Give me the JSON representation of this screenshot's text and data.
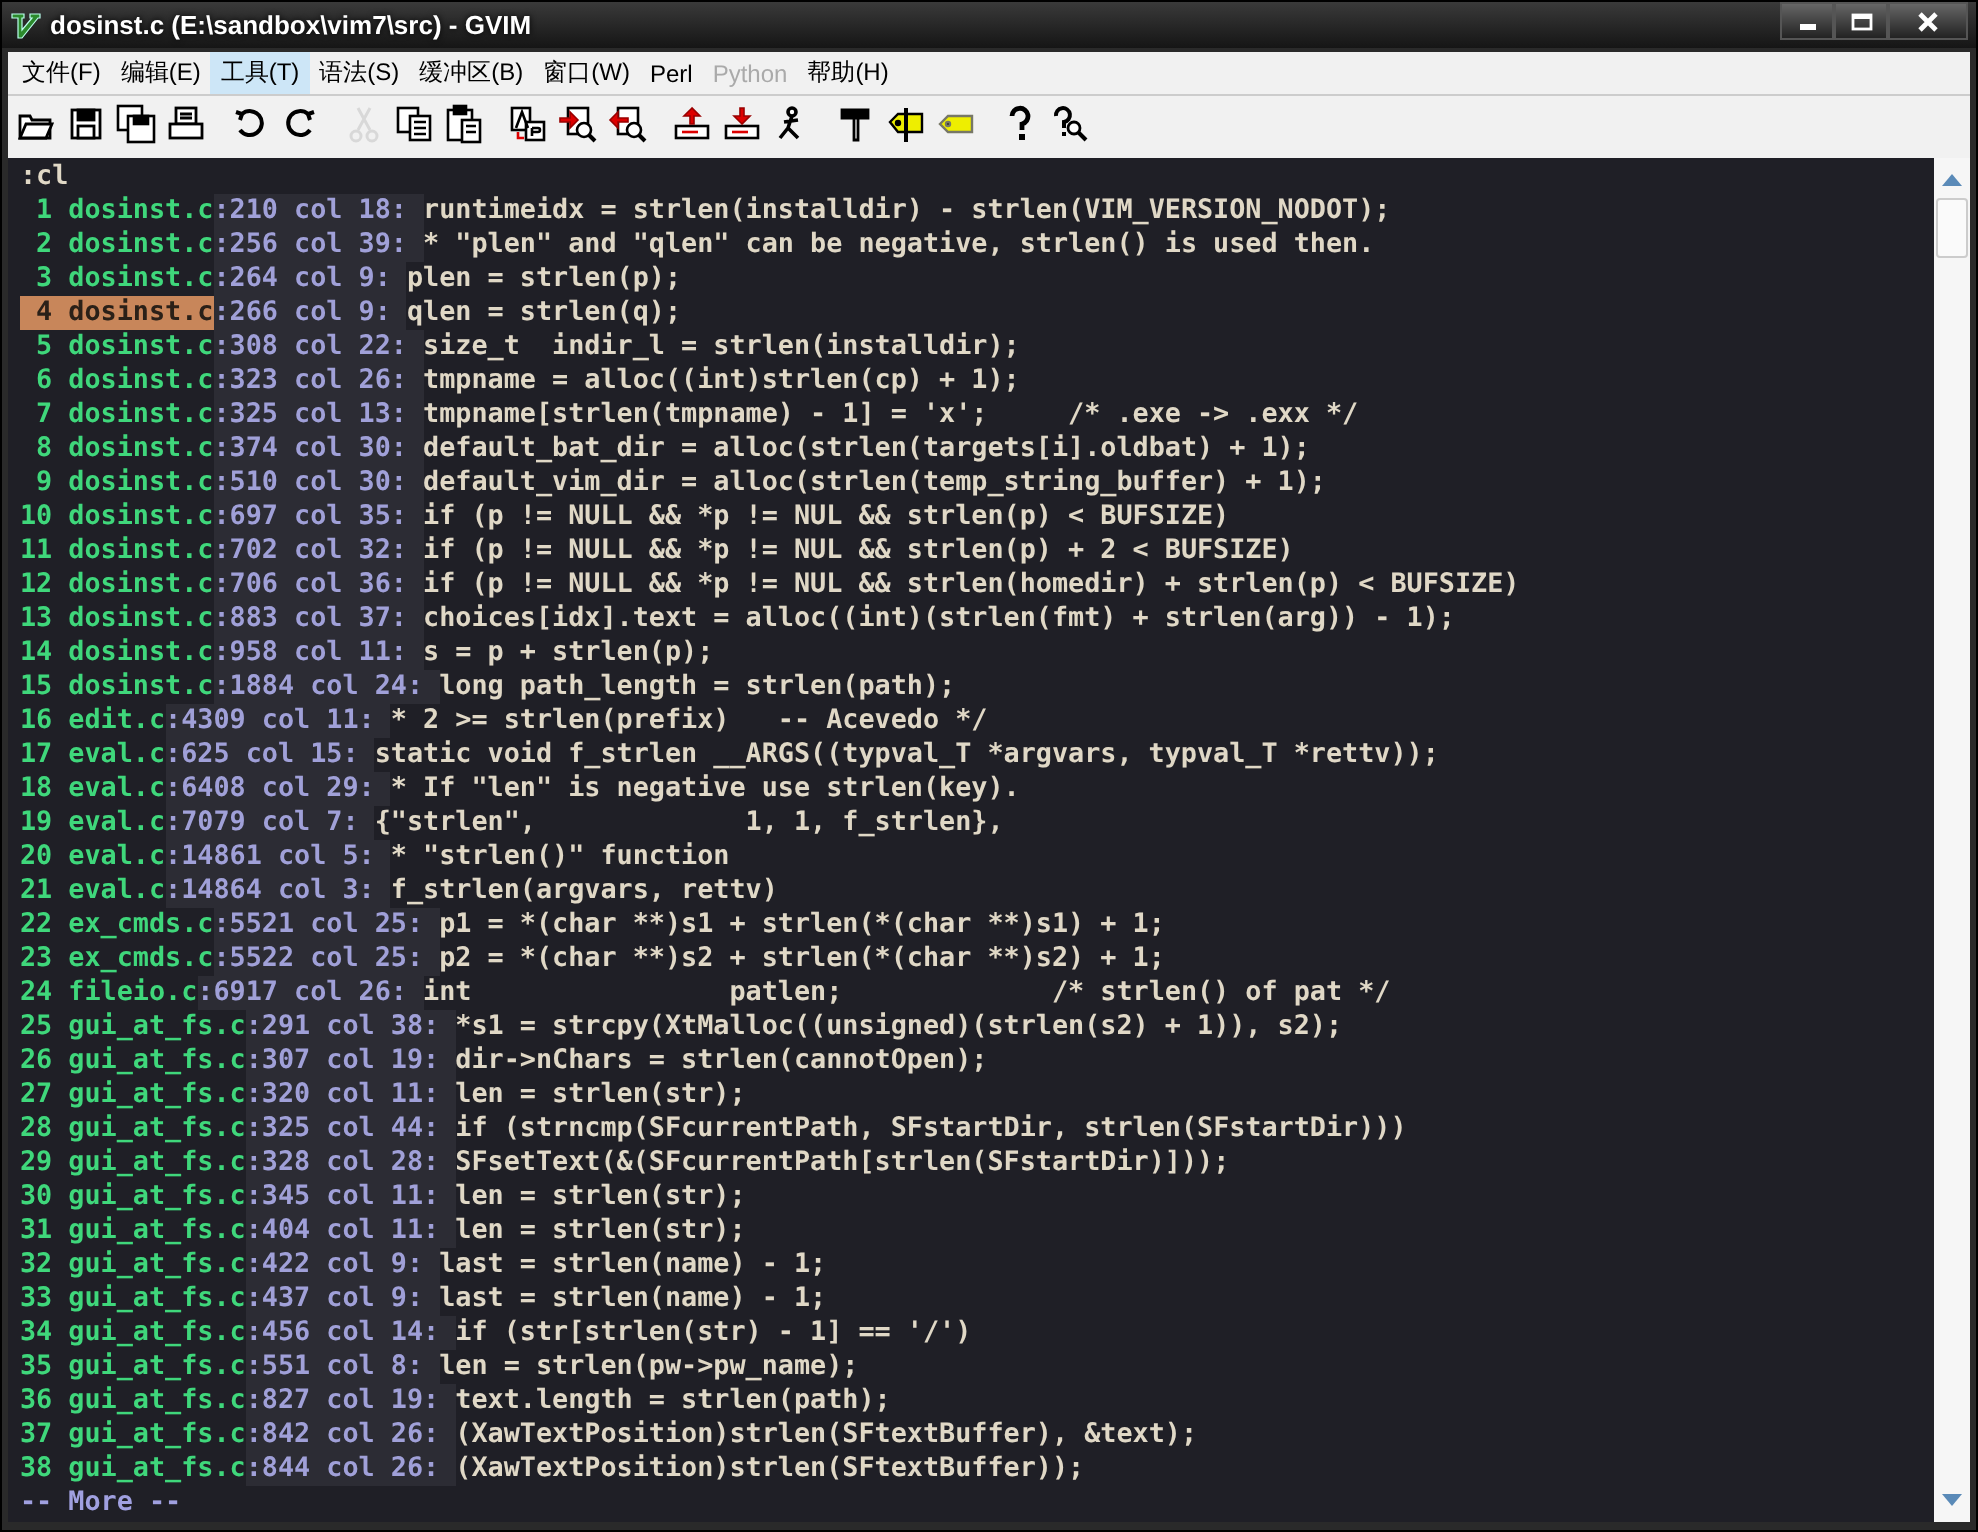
{
  "window": {
    "title": "dosinst.c (E:\\sandbox\\vim7\\src) - GVIM"
  },
  "menu": [
    {
      "label": "文件(F)",
      "selected": false,
      "disabled": false
    },
    {
      "label": "编辑(E)",
      "selected": false,
      "disabled": false
    },
    {
      "label": "工具(T)",
      "selected": true,
      "disabled": false
    },
    {
      "label": "语法(S)",
      "selected": false,
      "disabled": false
    },
    {
      "label": "缓冲区(B)",
      "selected": false,
      "disabled": false
    },
    {
      "label": "窗口(W)",
      "selected": false,
      "disabled": false
    },
    {
      "label": "Perl",
      "selected": false,
      "disabled": false
    },
    {
      "label": "Python",
      "selected": false,
      "disabled": true
    },
    {
      "label": "帮助(H)",
      "selected": false,
      "disabled": false
    }
  ],
  "toolbar": [
    {
      "buttons": [
        {
          "kind": "open",
          "disabled": false
        },
        {
          "kind": "save",
          "disabled": false
        },
        {
          "kind": "saveall",
          "disabled": false
        },
        {
          "kind": "print",
          "disabled": false
        }
      ]
    },
    {
      "buttons": [
        {
          "kind": "undo",
          "disabled": false
        },
        {
          "kind": "redo",
          "disabled": false
        }
      ]
    },
    {
      "buttons": [
        {
          "kind": "cut",
          "disabled": true
        },
        {
          "kind": "copy",
          "disabled": false
        },
        {
          "kind": "paste",
          "disabled": false
        }
      ]
    },
    {
      "buttons": [
        {
          "kind": "replace",
          "disabled": false
        },
        {
          "kind": "findnext",
          "disabled": false
        },
        {
          "kind": "findprev",
          "disabled": false
        }
      ]
    },
    {
      "buttons": [
        {
          "kind": "load",
          "disabled": false
        },
        {
          "kind": "store",
          "disabled": false
        },
        {
          "kind": "run",
          "disabled": false
        }
      ]
    },
    {
      "buttons": [
        {
          "kind": "make",
          "disabled": false
        },
        {
          "kind": "tags",
          "disabled": false
        },
        {
          "kind": "tag",
          "disabled": false
        }
      ]
    },
    {
      "buttons": [
        {
          "kind": "help",
          "disabled": false
        },
        {
          "kind": "findhelp",
          "disabled": false
        }
      ]
    }
  ],
  "editor": {
    "command": ":cl",
    "lines": [
      {
        "num": "1",
        "file": "dosinst.c",
        "loc": ":210 col 18:",
        "text": "runtimeidx = strlen(installdir) - strlen(VIM_VERSION_NODOT);",
        "selected": false
      },
      {
        "num": "2",
        "file": "dosinst.c",
        "loc": ":256 col 39:",
        "text": "* \"plen\" and \"qlen\" can be negative, strlen() is used then.",
        "selected": false
      },
      {
        "num": "3",
        "file": "dosinst.c",
        "loc": ":264 col 9:",
        "text": "plen = strlen(p);",
        "selected": false
      },
      {
        "num": "4",
        "file": "dosinst.c",
        "loc": ":266 col 9:",
        "text": "qlen = strlen(q);",
        "selected": true
      },
      {
        "num": "5",
        "file": "dosinst.c",
        "loc": ":308 col 22:",
        "text": "size_t  indir_l = strlen(installdir);",
        "selected": false
      },
      {
        "num": "6",
        "file": "dosinst.c",
        "loc": ":323 col 26:",
        "text": "tmpname = alloc((int)strlen(cp) + 1);",
        "selected": false
      },
      {
        "num": "7",
        "file": "dosinst.c",
        "loc": ":325 col 13:",
        "text": "tmpname[strlen(tmpname) - 1] = 'x';     /* .exe -> .exx */",
        "selected": false
      },
      {
        "num": "8",
        "file": "dosinst.c",
        "loc": ":374 col 30:",
        "text": "default_bat_dir = alloc(strlen(targets[i].oldbat) + 1);",
        "selected": false
      },
      {
        "num": "9",
        "file": "dosinst.c",
        "loc": ":510 col 30:",
        "text": "default_vim_dir = alloc(strlen(temp_string_buffer) + 1);",
        "selected": false
      },
      {
        "num": "10",
        "file": "dosinst.c",
        "loc": ":697 col 35:",
        "text": "if (p != NULL && *p != NUL && strlen(p) < BUFSIZE)",
        "selected": false
      },
      {
        "num": "11",
        "file": "dosinst.c",
        "loc": ":702 col 32:",
        "text": "if (p != NULL && *p != NUL && strlen(p) + 2 < BUFSIZE)",
        "selected": false
      },
      {
        "num": "12",
        "file": "dosinst.c",
        "loc": ":706 col 36:",
        "text": "if (p != NULL && *p != NUL && strlen(homedir) + strlen(p) < BUFSIZE)",
        "selected": false
      },
      {
        "num": "13",
        "file": "dosinst.c",
        "loc": ":883 col 37:",
        "text": "choices[idx].text = alloc((int)(strlen(fmt) + strlen(arg)) - 1);",
        "selected": false
      },
      {
        "num": "14",
        "file": "dosinst.c",
        "loc": ":958 col 11:",
        "text": "s = p + strlen(p);",
        "selected": false
      },
      {
        "num": "15",
        "file": "dosinst.c",
        "loc": ":1884 col 24:",
        "text": "long path_length = strlen(path);",
        "selected": false
      },
      {
        "num": "16",
        "file": "edit.c",
        "loc": ":4309 col 11:",
        "text": "* 2 >= strlen(prefix)   -- Acevedo */",
        "selected": false
      },
      {
        "num": "17",
        "file": "eval.c",
        "loc": ":625 col 15:",
        "text": "static void f_strlen __ARGS((typval_T *argvars, typval_T *rettv));",
        "selected": false
      },
      {
        "num": "18",
        "file": "eval.c",
        "loc": ":6408 col 29:",
        "text": "* If \"len\" is negative use strlen(key).",
        "selected": false
      },
      {
        "num": "19",
        "file": "eval.c",
        "loc": ":7079 col 7:",
        "text": "{\"strlen\",             1, 1, f_strlen},",
        "selected": false
      },
      {
        "num": "20",
        "file": "eval.c",
        "loc": ":14861 col 5:",
        "text": "* \"strlen()\" function",
        "selected": false
      },
      {
        "num": "21",
        "file": "eval.c",
        "loc": ":14864 col 3:",
        "text": "f_strlen(argvars, rettv)",
        "selected": false
      },
      {
        "num": "22",
        "file": "ex_cmds.c",
        "loc": ":5521 col 25:",
        "text": "p1 = *(char **)s1 + strlen(*(char **)s1) + 1;",
        "selected": false
      },
      {
        "num": "23",
        "file": "ex_cmds.c",
        "loc": ":5522 col 25:",
        "text": "p2 = *(char **)s2 + strlen(*(char **)s2) + 1;",
        "selected": false
      },
      {
        "num": "24",
        "file": "fileio.c",
        "loc": ":6917 col 26:",
        "text": "int                patlen;             /* strlen() of pat */",
        "selected": false
      },
      {
        "num": "25",
        "file": "gui_at_fs.c",
        "loc": ":291 col 38:",
        "text": "*s1 = strcpy(XtMalloc((unsigned)(strlen(s2) + 1)), s2);",
        "selected": false
      },
      {
        "num": "26",
        "file": "gui_at_fs.c",
        "loc": ":307 col 19:",
        "text": "dir->nChars = strlen(cannotOpen);",
        "selected": false
      },
      {
        "num": "27",
        "file": "gui_at_fs.c",
        "loc": ":320 col 11:",
        "text": "len = strlen(str);",
        "selected": false
      },
      {
        "num": "28",
        "file": "gui_at_fs.c",
        "loc": ":325 col 44:",
        "text": "if (strncmp(SFcurrentPath, SFstartDir, strlen(SFstartDir)))",
        "selected": false
      },
      {
        "num": "29",
        "file": "gui_at_fs.c",
        "loc": ":328 col 28:",
        "text": "SFsetText(&(SFcurrentPath[strlen(SFstartDir)]));",
        "selected": false
      },
      {
        "num": "30",
        "file": "gui_at_fs.c",
        "loc": ":345 col 11:",
        "text": "len = strlen(str);",
        "selected": false
      },
      {
        "num": "31",
        "file": "gui_at_fs.c",
        "loc": ":404 col 11:",
        "text": "len = strlen(str);",
        "selected": false
      },
      {
        "num": "32",
        "file": "gui_at_fs.c",
        "loc": ":422 col 9:",
        "text": "last = strlen(name) - 1;",
        "selected": false
      },
      {
        "num": "33",
        "file": "gui_at_fs.c",
        "loc": ":437 col 9:",
        "text": "last = strlen(name) - 1;",
        "selected": false
      },
      {
        "num": "34",
        "file": "gui_at_fs.c",
        "loc": ":456 col 14:",
        "text": "if (str[strlen(str) - 1] == '/')",
        "selected": false
      },
      {
        "num": "35",
        "file": "gui_at_fs.c",
        "loc": ":551 col 8:",
        "text": "len = strlen(pw->pw_name);",
        "selected": false
      },
      {
        "num": "36",
        "file": "gui_at_fs.c",
        "loc": ":827 col 19:",
        "text": "text.length = strlen(path);",
        "selected": false
      },
      {
        "num": "37",
        "file": "gui_at_fs.c",
        "loc": ":842 col 26:",
        "text": "(XawTextPosition)strlen(SFtextBuffer), &text);",
        "selected": false
      },
      {
        "num": "38",
        "file": "gui_at_fs.c",
        "loc": ":844 col 26:",
        "text": "(XawTextPosition)strlen(SFtextBuffer));",
        "selected": false
      }
    ],
    "prompt": "-- More --"
  }
}
